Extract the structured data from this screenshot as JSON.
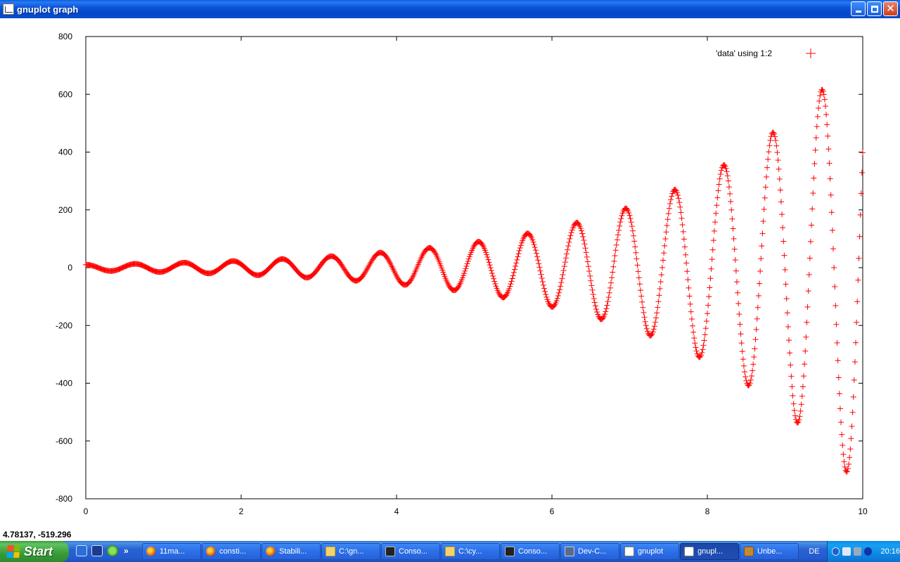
{
  "window": {
    "title": "gnuplot graph",
    "buttons": {
      "minimize": "",
      "maximize": "",
      "close": "✕"
    }
  },
  "status": {
    "coordinates": "4.78137, -519.296"
  },
  "chart_data": {
    "type": "scatter",
    "title": "",
    "xlabel": "",
    "ylabel": "",
    "xlim": [
      0,
      10
    ],
    "ylim": [
      -800,
      800
    ],
    "xticks": [
      0,
      2,
      4,
      6,
      8,
      10
    ],
    "yticks": [
      -800,
      -600,
      -400,
      -200,
      0,
      200,
      400,
      600,
      800
    ],
    "grid": false,
    "legend_position": "top-right",
    "marker": "+",
    "series": [
      {
        "name": "'data' using 1:2",
        "color": "#ff0000",
        "model": {
          "amplitude": 10,
          "growth": 0.435,
          "frequency": 9.95,
          "phase": 1.5708,
          "sample_step": 0.01
        },
        "extrema": [
          {
            "x": 0.0,
            "y": 10
          },
          {
            "x": 0.3,
            "y": -12
          },
          {
            "x": 0.65,
            "y": 14
          },
          {
            "x": 0.95,
            "y": -16
          },
          {
            "x": 1.28,
            "y": 18
          },
          {
            "x": 1.58,
            "y": -20
          },
          {
            "x": 1.9,
            "y": 23
          },
          {
            "x": 2.2,
            "y": -26
          },
          {
            "x": 2.53,
            "y": 30
          },
          {
            "x": 2.84,
            "y": -34
          },
          {
            "x": 3.16,
            "y": 40
          },
          {
            "x": 3.47,
            "y": -46
          },
          {
            "x": 3.79,
            "y": 53
          },
          {
            "x": 4.1,
            "y": -60
          },
          {
            "x": 4.42,
            "y": 70
          },
          {
            "x": 4.73,
            "y": -82
          },
          {
            "x": 5.05,
            "y": 97
          },
          {
            "x": 5.36,
            "y": -110
          },
          {
            "x": 5.68,
            "y": 125
          },
          {
            "x": 5.98,
            "y": -145
          },
          {
            "x": 6.3,
            "y": 170
          },
          {
            "x": 6.61,
            "y": -190
          },
          {
            "x": 6.93,
            "y": 225
          },
          {
            "x": 7.24,
            "y": -255
          },
          {
            "x": 7.56,
            "y": 295
          },
          {
            "x": 7.87,
            "y": -340
          },
          {
            "x": 8.19,
            "y": 395
          },
          {
            "x": 8.5,
            "y": -450
          },
          {
            "x": 8.82,
            "y": 520
          },
          {
            "x": 9.13,
            "y": -600
          },
          {
            "x": 9.45,
            "y": 690
          },
          {
            "x": 9.76,
            "y": -795
          }
        ]
      }
    ]
  },
  "taskbar": {
    "start_label": "Start",
    "quick_launch_more": "»",
    "items": [
      {
        "label": "11ma...",
        "icon": "firefox-icon",
        "active": false
      },
      {
        "label": "consti...",
        "icon": "firefox-icon",
        "active": false
      },
      {
        "label": "Stabili...",
        "icon": "firefox-icon",
        "active": false
      },
      {
        "label": "C:\\gn...",
        "icon": "folder-icon",
        "active": false
      },
      {
        "label": "Conso...",
        "icon": "console-icon",
        "active": false
      },
      {
        "label": "C:\\cy...",
        "icon": "folder-icon",
        "active": false
      },
      {
        "label": "Conso...",
        "icon": "console-icon",
        "active": false
      },
      {
        "label": "Dev-C...",
        "icon": "devcpp-icon",
        "active": false
      },
      {
        "label": "gnuplot",
        "icon": "gnuplot-icon",
        "active": false
      },
      {
        "label": "gnupl...",
        "icon": "gnuplot-graph-icon",
        "active": true
      },
      {
        "label": "Unbe...",
        "icon": "unbe-icon",
        "active": false
      }
    ],
    "language": "DE",
    "clock": "20:16"
  }
}
